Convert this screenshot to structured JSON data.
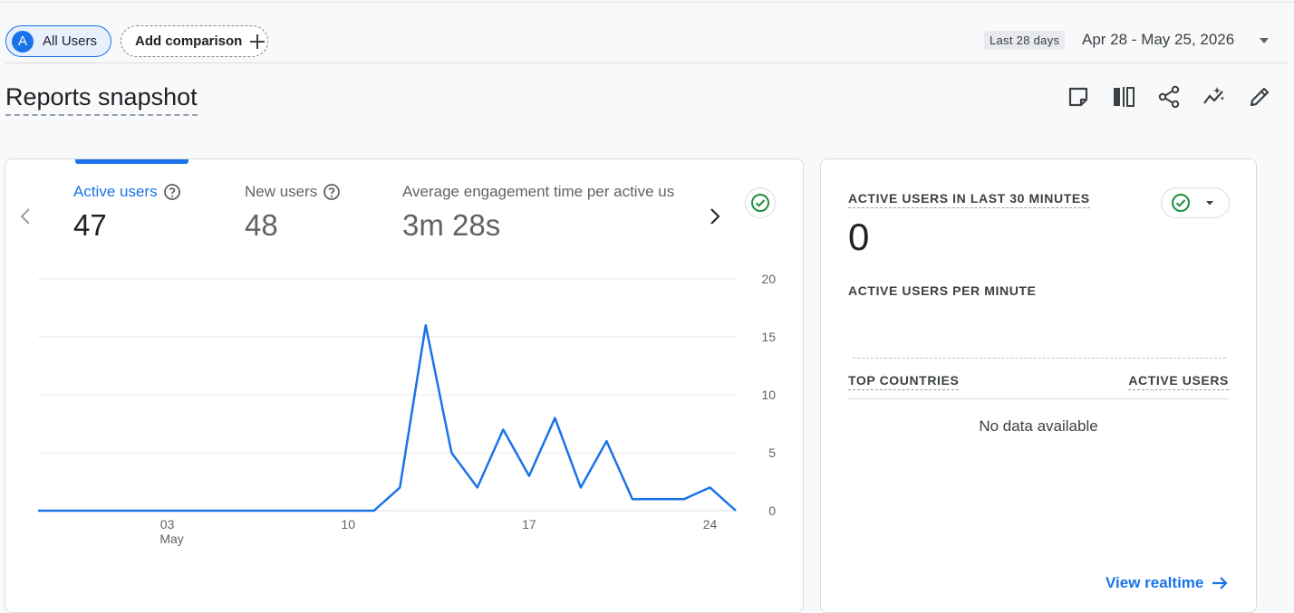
{
  "filters": {
    "audience_initial": "A",
    "audience_label": "All Users",
    "add_comparison_label": "Add comparison"
  },
  "date": {
    "badge": "Last 28 days",
    "range": "Apr 28 - May 25, 2026"
  },
  "page_title": "Reports snapshot",
  "toolbar": {
    "icons": [
      "note-icon",
      "compare-columns-icon",
      "share-icon",
      "insights-icon",
      "edit-icon"
    ]
  },
  "metrics": [
    {
      "label": "Active users",
      "value": "47",
      "active": true
    },
    {
      "label": "New users",
      "value": "48",
      "active": false
    },
    {
      "label": "Average engagement time per active us",
      "value": "3m 28s",
      "active": false
    }
  ],
  "chart_data": {
    "type": "line",
    "series": [
      {
        "values": [
          0,
          0,
          0,
          0,
          0,
          0,
          0,
          0,
          0,
          0,
          0,
          0,
          0,
          0,
          2,
          16,
          5,
          2,
          7,
          3,
          8,
          2,
          6,
          1,
          1,
          1,
          2,
          0
        ]
      }
    ],
    "x": [
      "Apr 28",
      "Apr 29",
      "Apr 30",
      "May 01",
      "May 02",
      "May 03",
      "May 04",
      "May 05",
      "May 06",
      "May 07",
      "May 08",
      "May 09",
      "May 10",
      "May 11",
      "May 12",
      "May 13",
      "May 14",
      "May 15",
      "May 16",
      "May 17",
      "May 18",
      "May 19",
      "May 20",
      "May 21",
      "May 22",
      "May 23",
      "May 24",
      "May 25"
    ],
    "x_tick_labels": [
      {
        "label": "03",
        "sub": "May",
        "index": 5
      },
      {
        "label": "10",
        "sub": "",
        "index": 12
      },
      {
        "label": "17",
        "sub": "",
        "index": 19
      },
      {
        "label": "24",
        "sub": "",
        "index": 26
      }
    ],
    "y_ticks": [
      "0",
      "5",
      "10",
      "15",
      "20"
    ],
    "ylim": [
      0,
      20
    ],
    "y_axis_side": "right",
    "grid": true,
    "color": "#1a73e8"
  },
  "realtime": {
    "title": "ACTIVE USERS IN LAST 30 MINUTES",
    "value": "0",
    "per_minute_label": "ACTIVE USERS PER MINUTE",
    "col_countries": "TOP COUNTRIES",
    "col_users": "ACTIVE USERS",
    "no_data": "No data available",
    "link": "View realtime"
  },
  "colors": {
    "accent": "#1a73e8",
    "check": "#1e8e3e",
    "background": "#f8f9fa"
  }
}
